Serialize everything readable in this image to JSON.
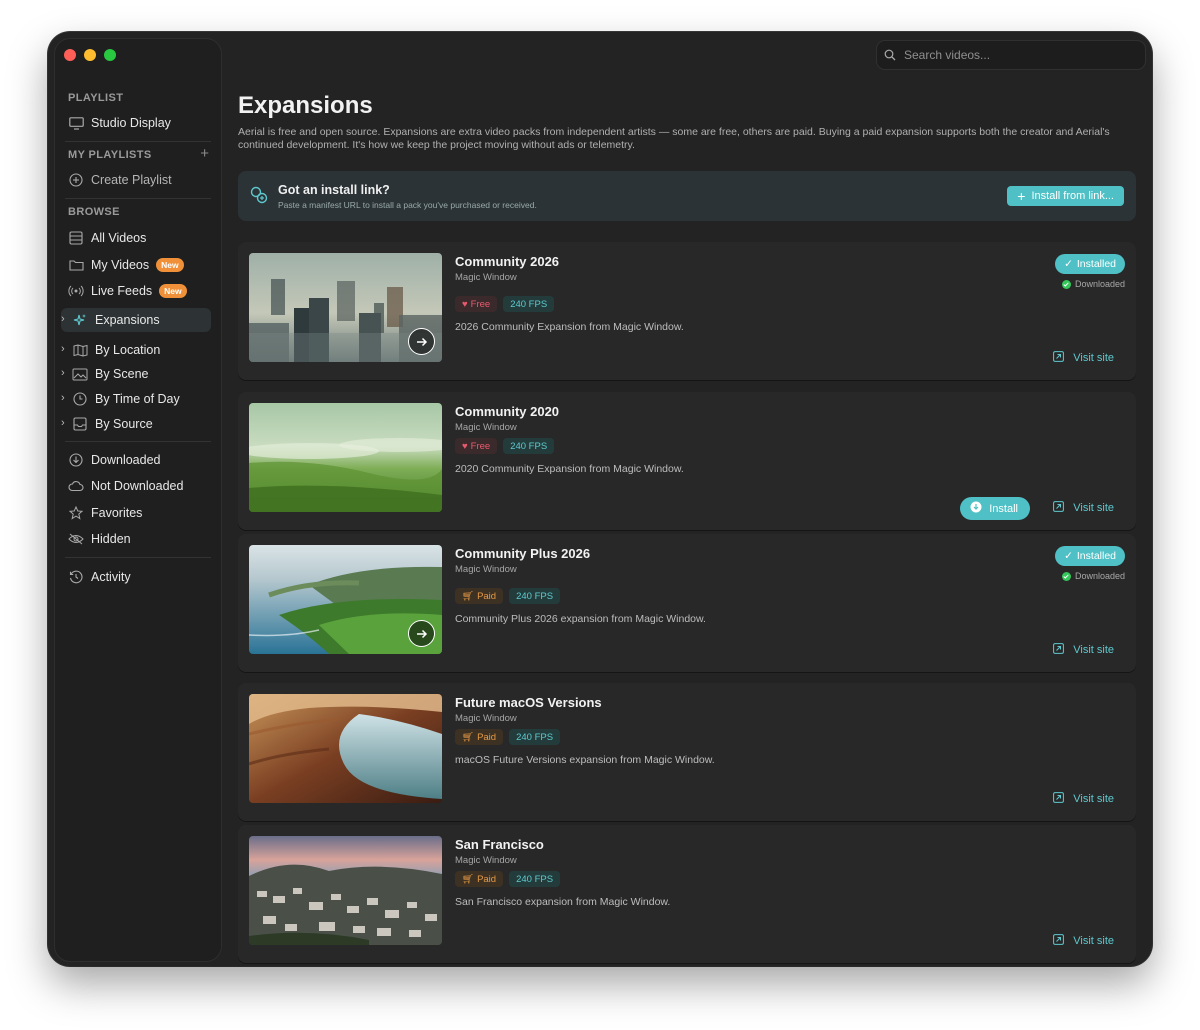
{
  "search": {
    "placeholder": "Search videos..."
  },
  "sidebar": {
    "playlist_header": "PLAYLIST",
    "display": "Studio Display",
    "my_playlists_header": "MY PLAYLISTS",
    "create_playlist": "Create Playlist",
    "browse_header": "BROWSE",
    "all_videos": "All Videos",
    "my_videos": "My Videos",
    "live_feeds": "Live Feeds",
    "new_badge": "New",
    "expansions": "Expansions",
    "by_location": "By Location",
    "by_scene": "By Scene",
    "by_time": "By Time of Day",
    "by_source": "By Source",
    "downloaded": "Downloaded",
    "not_downloaded": "Not Downloaded",
    "favorites": "Favorites",
    "hidden": "Hidden",
    "activity": "Activity"
  },
  "main": {
    "title": "Expansions",
    "description": "Aerial is free and open source. Expansions are extra video packs from independent artists — some are free, others are paid. Buying a paid expansion supports both the creator and Aerial's continued development. It's how we keep the project moving without ads or telemetry.",
    "banner": {
      "title": "Got an install link?",
      "subtitle": "Paste a manifest URL to install a pack you've purchased or received.",
      "button": "Install from link..."
    },
    "labels": {
      "installed": "Installed",
      "downloaded": "Downloaded",
      "visit_site": "Visit site",
      "install": "Install"
    },
    "cards": [
      {
        "name": "Community 2026",
        "author": "Magic Window",
        "price": "Free",
        "fps": "240 FPS",
        "description": "2026 Community Expansion from Magic Window.",
        "status": "installed"
      },
      {
        "name": "Community 2020",
        "author": "Magic Window",
        "price": "Free",
        "fps": "240 FPS",
        "description": "2020 Community Expansion from Magic Window.",
        "status": "install"
      },
      {
        "name": "Community Plus 2026",
        "author": "Magic Window",
        "price": "Paid",
        "fps": "240 FPS",
        "description": "Community Plus 2026 expansion from Magic Window.",
        "status": "installed"
      },
      {
        "name": "Future macOS Versions",
        "author": "Magic Window",
        "price": "Paid",
        "fps": "240 FPS",
        "description": "macOS Future Versions expansion from Magic Window.",
        "status": "none"
      },
      {
        "name": "San Francisco",
        "author": "Magic Window",
        "price": "Paid",
        "fps": "240 FPS",
        "description": "San Francisco expansion from Magic Window.",
        "status": "none"
      }
    ]
  },
  "colors": {
    "accent": "#4fc0c5",
    "free": "#e85a6e",
    "paid": "#e59a44",
    "window_bg": "#232323"
  }
}
